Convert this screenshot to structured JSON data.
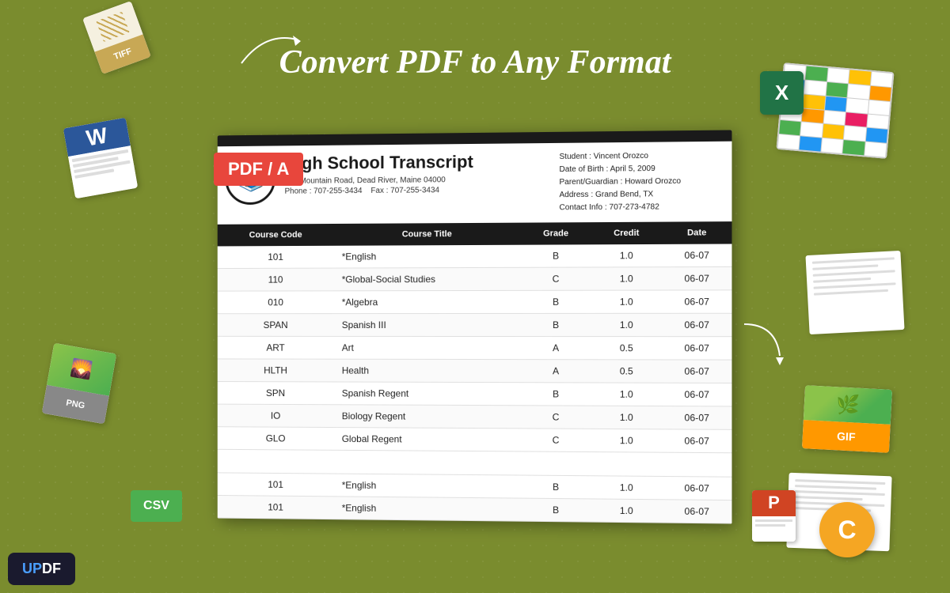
{
  "page": {
    "title": "Convert PDF to Any Format",
    "background_color": "#7a8c2e"
  },
  "pdf_badge": {
    "label": "PDF / A"
  },
  "document": {
    "school": {
      "name": "High School Transcript",
      "address": "123 Mountain Road, Dead River, Maine 04000",
      "phone": "Phone : 707-255-3434",
      "fax": "Fax : 707-255-3434"
    },
    "student": {
      "name": "Student : Vincent Orozco",
      "dob": "Date of Birth : April 5,  2009",
      "guardian": "Parent/Guardian : Howard Orozco",
      "address": "Address : Grand Bend, TX",
      "contact": "Contact Info : 707-273-4782"
    },
    "table": {
      "headers": [
        "Course Code",
        "Course Title",
        "Grade",
        "Credit",
        "Date"
      ],
      "rows": [
        [
          "101",
          "*English",
          "B",
          "1.0",
          "06-07"
        ],
        [
          "110",
          "*Global-Social Studies",
          "C",
          "1.0",
          "06-07"
        ],
        [
          "010",
          "*Algebra",
          "B",
          "1.0",
          "06-07"
        ],
        [
          "SPAN",
          "Spanish III",
          "B",
          "1.0",
          "06-07"
        ],
        [
          "ART",
          "Art",
          "A",
          "0.5",
          "06-07"
        ],
        [
          "HLTH",
          "Health",
          "A",
          "0.5",
          "06-07"
        ],
        [
          "SPN",
          "Spanish Regent",
          "B",
          "1.0",
          "06-07"
        ],
        [
          "IO",
          "Biology Regent",
          "C",
          "1.0",
          "06-07"
        ],
        [
          "GLO",
          "Global Regent",
          "C",
          "1.0",
          "06-07"
        ]
      ],
      "extra_rows": [
        [
          "101",
          "*English",
          "B",
          "1.0",
          "06-07"
        ],
        [
          "101",
          "*English",
          "B",
          "1.0",
          "06-07"
        ]
      ]
    }
  },
  "updf_logo": {
    "label": "UPDF"
  },
  "file_icons": {
    "tiff": "TIFF",
    "word": "W",
    "csv": "CSV",
    "excel": "X",
    "gif": "GIF",
    "powerpoint": "P",
    "c_lang": "C"
  }
}
